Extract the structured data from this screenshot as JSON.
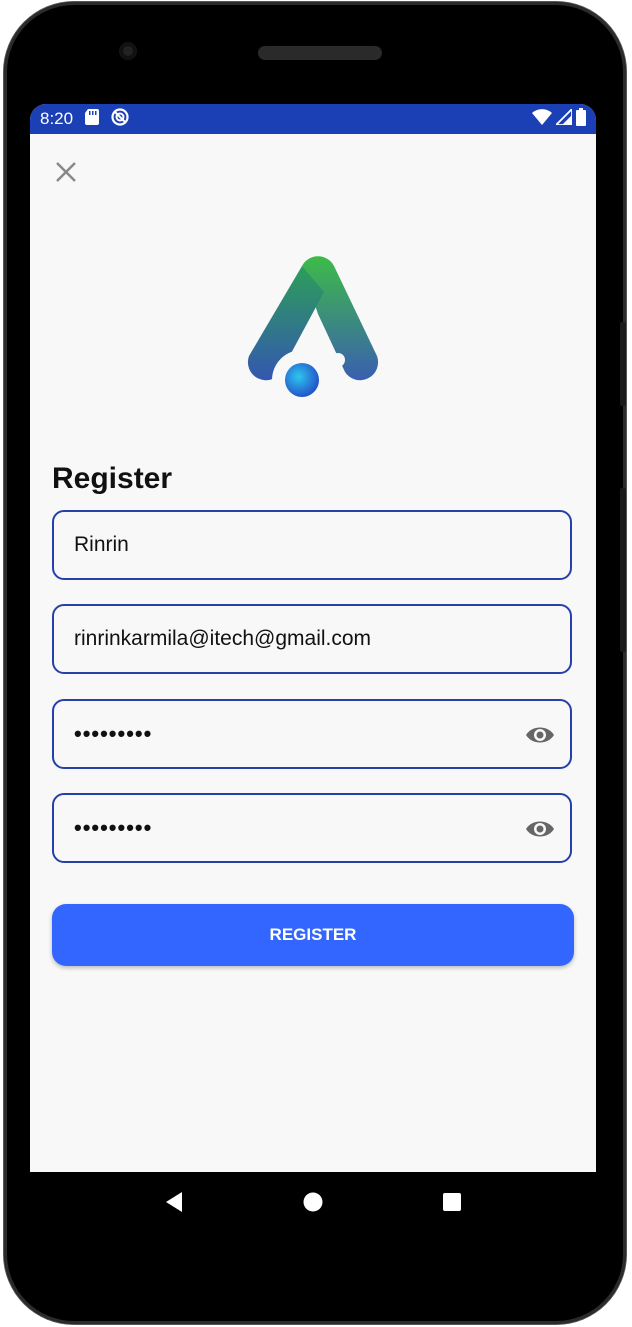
{
  "status_bar": {
    "time": "8:20",
    "icons_left": [
      "sd-card-icon",
      "do-not-disturb-icon"
    ],
    "icons_right": [
      "wifi-icon",
      "signal-icon",
      "battery-icon"
    ],
    "color": "#1b3fb5"
  },
  "form": {
    "title": "Register",
    "fields": [
      {
        "name": "name",
        "value": "Rinrin"
      },
      {
        "name": "email",
        "value": "rinrinkarmila@itech@gmail.com"
      },
      {
        "name": "password",
        "value": "•••••••••"
      },
      {
        "name": "confirm_password",
        "value": "•••••••••"
      }
    ],
    "submit_label": "REGISTER",
    "accent_color": "#3366ff",
    "border_color": "#2540a8"
  },
  "nav": {
    "icons": [
      "back-icon",
      "home-icon",
      "recents-icon"
    ]
  }
}
